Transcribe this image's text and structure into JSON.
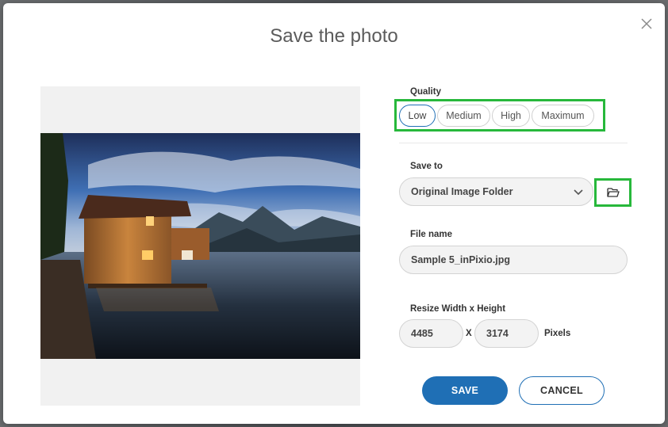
{
  "dialog": {
    "title": "Save the photo",
    "close_icon": "close-icon"
  },
  "preview": {
    "image_description_icon": "photo-lake-boathouse"
  },
  "quality": {
    "label": "Quality",
    "options": [
      "Low",
      "Medium",
      "High",
      "Maximum"
    ],
    "selected": "Low"
  },
  "save_to": {
    "label": "Save to",
    "value": "Original Image Folder",
    "chevron_icon": "chevron-down-icon",
    "browse_icon": "folder-open-icon"
  },
  "file_name": {
    "label": "File name",
    "value": "Sample 5_inPixio.jpg"
  },
  "resize": {
    "label": "Resize Width x Height",
    "width": "4485",
    "separator": "X",
    "height": "3174",
    "unit": "Pixels"
  },
  "actions": {
    "save_label": "SAVE",
    "cancel_label": "CANCEL"
  },
  "colors": {
    "accent": "#1f6fb5",
    "highlight": "#27b83b"
  }
}
